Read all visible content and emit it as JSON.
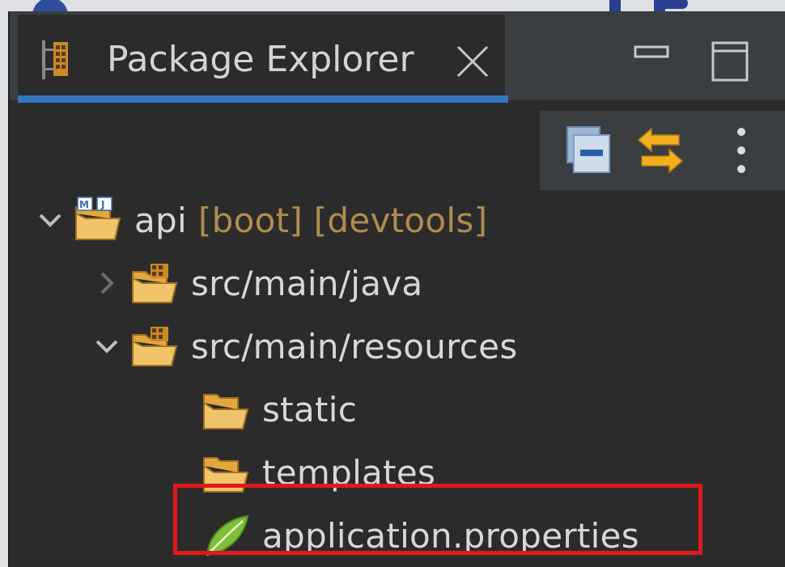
{
  "tab": {
    "title": "Package Explorer"
  },
  "icons": {
    "tab": "package-explorer-icon",
    "close": "close-icon",
    "minimize": "minimize-icon",
    "maximize": "maximize-icon",
    "collapse_all": "collapse-all-icon",
    "link_with_editor": "link-with-editor-icon",
    "view_menu": "view-menu-icon"
  },
  "tree": {
    "project": {
      "name": "api",
      "decorations": "[boot] [devtools]",
      "expanded": true
    },
    "items": [
      {
        "label": "src/main/java",
        "type": "source-folder",
        "expanded": false
      },
      {
        "label": "src/main/resources",
        "type": "source-folder",
        "expanded": true
      },
      {
        "label": "static",
        "type": "folder"
      },
      {
        "label": "templates",
        "type": "folder"
      },
      {
        "label": "application.properties",
        "type": "spring-properties-file",
        "highlighted": true
      }
    ]
  },
  "colors": {
    "tab_accent": "#3576c2",
    "highlight_border": "#e01a1a",
    "decoration_text": "#b08d4e"
  }
}
